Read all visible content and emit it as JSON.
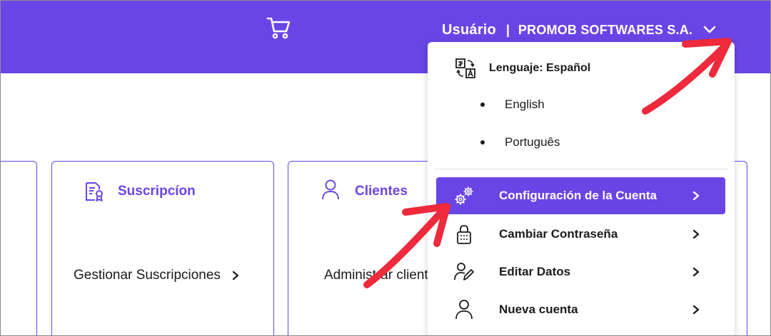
{
  "header": {
    "cart_icon": "cart-icon",
    "user_label": "Usuário",
    "separator": "|",
    "company": "PROMOB SOFTWARES S.A.",
    "dropdown_icon": "chevron-down-icon",
    "background_color": "#6a45e6"
  },
  "cards": [
    {
      "title": "Suscripcíon",
      "icon": "certificate-icon",
      "link": "Gestionar Suscripciones"
    },
    {
      "title": "Clientes",
      "icon": "user-icon",
      "link": "Administrar clientes"
    }
  ],
  "dropdown": {
    "language_label": "Lenguaje: Español",
    "language_icon": "translate-icon",
    "languages": [
      "English",
      "Português"
    ],
    "items": [
      {
        "label": "Configuración de la Cuenta",
        "icon": "gears-icon",
        "active": true
      },
      {
        "label": "Cambiar Contraseña",
        "icon": "lock-icon",
        "active": false
      },
      {
        "label": "Editar Datos",
        "icon": "edit-user-icon",
        "active": false
      },
      {
        "label": "Nueva cuenta",
        "icon": "user-icon",
        "active": false
      }
    ]
  },
  "colors": {
    "accent": "#6a45e6",
    "annotation_arrow": "#ee2a3c"
  }
}
